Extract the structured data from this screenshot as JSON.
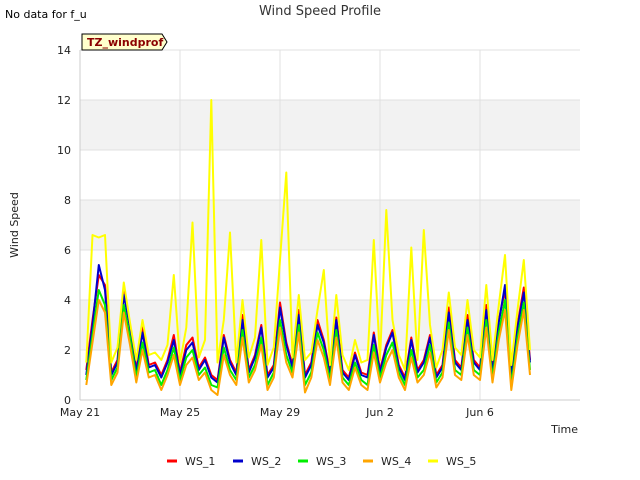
{
  "note": "No data for f_u",
  "chart_data": {
    "type": "line",
    "title": "Wind Speed Profile",
    "xlabel": "Time",
    "ylabel": "Wind Speed",
    "tag": "TZ_windprof",
    "ylim": [
      0,
      14
    ],
    "xlim": [
      "2024-05-21",
      "2024-06-10"
    ],
    "x_ticks": [
      {
        "date": "2024-05-21",
        "label": "May 21"
      },
      {
        "date": "2024-05-25",
        "label": "May 25"
      },
      {
        "date": "2024-05-29",
        "label": "May 29"
      },
      {
        "date": "2024-06-02",
        "label": "Jun 2"
      },
      {
        "date": "2024-06-06",
        "label": "Jun 6"
      }
    ],
    "y_ticks": [
      0,
      2,
      4,
      6,
      8,
      10,
      12,
      14
    ],
    "grid": true,
    "legend": "bottom",
    "x": [
      "2024-05-21 06:00",
      "2024-05-21 12:00",
      "2024-05-21 18:00",
      "2024-05-22 00:00",
      "2024-05-22 06:00",
      "2024-05-22 12:00",
      "2024-05-22 18:00",
      "2024-05-23 00:00",
      "2024-05-23 06:00",
      "2024-05-23 12:00",
      "2024-05-23 18:00",
      "2024-05-24 00:00",
      "2024-05-24 06:00",
      "2024-05-24 12:00",
      "2024-05-24 18:00",
      "2024-05-25 00:00",
      "2024-05-25 06:00",
      "2024-05-25 12:00",
      "2024-05-25 18:00",
      "2024-05-26 00:00",
      "2024-05-26 06:00",
      "2024-05-26 12:00",
      "2024-05-26 18:00",
      "2024-05-27 00:00",
      "2024-05-27 06:00",
      "2024-05-27 12:00",
      "2024-05-27 18:00",
      "2024-05-28 00:00",
      "2024-05-28 06:00",
      "2024-05-28 12:00",
      "2024-05-28 18:00",
      "2024-05-29 00:00",
      "2024-05-29 06:00",
      "2024-05-29 12:00",
      "2024-05-29 18:00",
      "2024-05-30 00:00",
      "2024-05-30 06:00",
      "2024-05-30 12:00",
      "2024-05-30 18:00",
      "2024-05-31 00:00",
      "2024-05-31 06:00",
      "2024-05-31 12:00",
      "2024-05-31 18:00",
      "2024-06-01 00:00",
      "2024-06-01 06:00",
      "2024-06-01 12:00",
      "2024-06-01 18:00",
      "2024-06-02 00:00",
      "2024-06-02 06:00",
      "2024-06-02 12:00",
      "2024-06-02 18:00",
      "2024-06-03 00:00",
      "2024-06-03 06:00",
      "2024-06-03 12:00",
      "2024-06-03 18:00",
      "2024-06-04 00:00",
      "2024-06-04 06:00",
      "2024-06-04 12:00",
      "2024-06-04 18:00",
      "2024-06-05 00:00",
      "2024-06-05 06:00",
      "2024-06-05 12:00",
      "2024-06-05 18:00",
      "2024-06-06 00:00",
      "2024-06-06 06:00",
      "2024-06-06 12:00",
      "2024-06-06 18:00",
      "2024-06-07 00:00",
      "2024-06-07 06:00",
      "2024-06-07 12:00",
      "2024-06-07 18:00",
      "2024-06-08 00:00"
    ],
    "series": [
      {
        "name": "WS_1",
        "color": "#ff0000",
        "values": [
          1.2,
          3.2,
          5.0,
          4.6,
          1.1,
          1.6,
          4.4,
          3.0,
          1.2,
          2.9,
          1.4,
          1.5,
          1.0,
          1.6,
          2.6,
          1.1,
          2.2,
          2.5,
          1.3,
          1.7,
          1.0,
          0.8,
          2.6,
          1.6,
          1.1,
          3.4,
          1.2,
          1.8,
          3.0,
          1.0,
          1.4,
          3.9,
          2.3,
          1.4,
          3.6,
          1.0,
          1.5,
          3.2,
          2.4,
          1.1,
          3.3,
          1.2,
          0.9,
          1.9,
          1.1,
          1.0,
          2.7,
          1.2,
          2.2,
          2.8,
          1.4,
          0.9,
          2.5,
          1.2,
          1.6,
          2.6,
          1.0,
          1.4,
          3.7,
          1.6,
          1.3,
          3.4,
          1.6,
          1.3,
          3.8,
          1.2,
          3.2,
          4.4,
          1.0,
          3.0,
          4.5,
          1.6
        ]
      },
      {
        "name": "WS_2",
        "color": "#0000cc",
        "values": [
          1.0,
          3.0,
          5.4,
          4.4,
          1.0,
          1.5,
          4.2,
          2.9,
          1.1,
          2.7,
          1.3,
          1.4,
          0.9,
          1.5,
          2.4,
          1.0,
          2.0,
          2.3,
          1.2,
          1.6,
          0.9,
          0.7,
          2.5,
          1.5,
          1.0,
          3.2,
          1.1,
          1.7,
          2.9,
          0.9,
          1.3,
          3.7,
          2.2,
          1.3,
          3.4,
          0.9,
          1.4,
          3.0,
          2.3,
          1.0,
          3.2,
          1.1,
          0.8,
          1.8,
          1.0,
          0.9,
          2.6,
          1.1,
          2.1,
          2.7,
          1.3,
          0.8,
          2.4,
          1.1,
          1.5,
          2.5,
          0.9,
          1.3,
          3.5,
          1.5,
          1.2,
          3.2,
          1.5,
          1.2,
          3.6,
          1.1,
          3.1,
          4.6,
          0.9,
          2.9,
          4.3,
          1.5
        ]
      },
      {
        "name": "WS_3",
        "color": "#00ee00",
        "values": [
          0.8,
          2.6,
          4.4,
          3.8,
          0.8,
          1.3,
          3.8,
          2.5,
          0.9,
          2.3,
          1.1,
          1.2,
          0.6,
          1.2,
          2.1,
          0.8,
          1.7,
          2.0,
          1.0,
          1.3,
          0.6,
          0.5,
          2.1,
          1.2,
          0.8,
          2.8,
          0.9,
          1.4,
          2.5,
          0.6,
          1.1,
          3.2,
          1.8,
          1.1,
          3.0,
          0.6,
          1.1,
          2.7,
          2.0,
          0.8,
          2.8,
          0.9,
          0.6,
          1.5,
          0.8,
          0.6,
          2.2,
          0.9,
          1.8,
          2.3,
          1.1,
          0.6,
          2.0,
          0.9,
          1.2,
          2.2,
          0.7,
          1.1,
          3.1,
          1.2,
          1.0,
          2.9,
          1.2,
          1.0,
          3.2,
          0.9,
          2.7,
          4.0,
          0.6,
          2.5,
          3.9,
          1.2
        ]
      },
      {
        "name": "WS_4",
        "color": "#ffa500",
        "values": [
          0.6,
          2.3,
          4.0,
          3.5,
          0.6,
          1.1,
          3.5,
          2.2,
          0.7,
          2.0,
          0.9,
          1.0,
          0.4,
          1.0,
          1.8,
          0.6,
          1.4,
          1.7,
          0.8,
          1.1,
          0.4,
          0.2,
          1.8,
          1.0,
          0.6,
          2.5,
          0.7,
          1.2,
          2.2,
          0.4,
          0.9,
          2.9,
          1.5,
          0.9,
          2.7,
          0.3,
          0.9,
          2.4,
          1.7,
          0.6,
          2.5,
          0.7,
          0.4,
          1.3,
          0.6,
          0.4,
          1.9,
          0.7,
          1.5,
          2.0,
          0.9,
          0.4,
          1.7,
          0.7,
          1.0,
          1.9,
          0.5,
          0.9,
          2.8,
          1.0,
          0.8,
          2.6,
          1.0,
          0.8,
          2.9,
          0.7,
          2.4,
          3.6,
          0.4,
          2.2,
          3.6,
          1.0
        ]
      },
      {
        "name": "WS_5",
        "color": "#ffff00",
        "values": [
          1.5,
          6.6,
          6.5,
          6.6,
          1.5,
          2.1,
          4.7,
          3.1,
          1.6,
          3.2,
          1.8,
          1.9,
          1.6,
          2.2,
          5.0,
          1.5,
          2.9,
          7.1,
          1.7,
          2.4,
          12.0,
          1.5,
          3.2,
          6.7,
          1.5,
          4.0,
          1.7,
          2.5,
          6.4,
          1.4,
          2.1,
          5.6,
          9.1,
          1.7,
          4.2,
          1.6,
          1.9,
          3.6,
          5.2,
          1.4,
          4.2,
          1.8,
          1.2,
          2.4,
          1.5,
          1.6,
          6.4,
          1.6,
          7.6,
          3.2,
          1.8,
          1.2,
          6.1,
          1.6,
          6.8,
          3.0,
          1.3,
          2.0,
          4.3,
          2.1,
          1.8,
          4.0,
          2.0,
          1.7,
          4.6,
          1.6,
          3.8,
          5.8,
          1.4,
          3.6,
          5.6,
          2.0
        ]
      }
    ]
  }
}
